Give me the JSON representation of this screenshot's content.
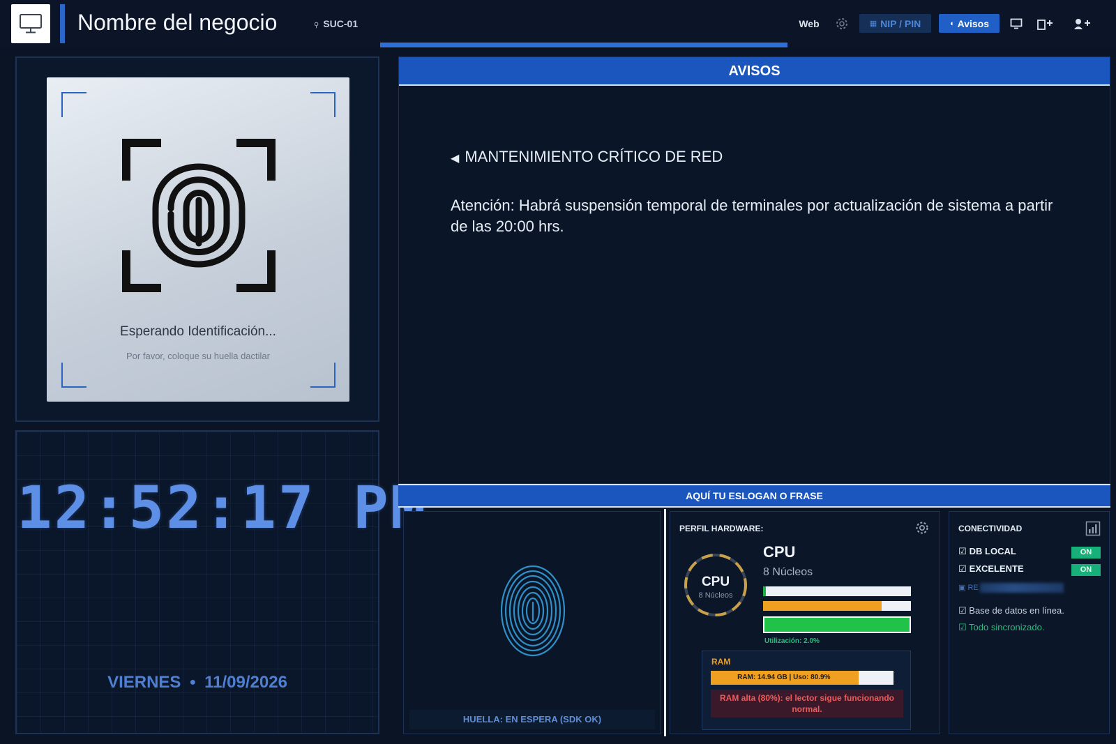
{
  "header": {
    "business_name": "Nombre del negocio",
    "branch": "SUC-01",
    "progress": 1,
    "nav": {
      "web": "Web",
      "nip_pin": "NIP / PIN",
      "avisos": "Avisos"
    },
    "icons": [
      "monitor-icon",
      "gear-icon",
      "keypad-icon",
      "megaphone-icon",
      "screen-icon",
      "add-device-icon",
      "add-user-icon"
    ]
  },
  "scanner": {
    "status": "Esperando Identificación...",
    "hint": "Por favor, coloque su huella dactilar"
  },
  "clock": {
    "time": "12:52:17 PM",
    "day": "VIERNES",
    "date": "11/09/2026"
  },
  "avisos": {
    "header": "AVISOS",
    "notice_title": "MANTENIMIENTO CRÍTICO DE RED",
    "notice_body": "Atención: Habrá suspensión temporal de terminales por actualización de sistema a partir de las 20:00 hrs."
  },
  "slogan": "AQUÍ TU ESLOGAN O FRASE",
  "huella": {
    "status": "HUELLA: EN ESPERA (SDK OK)"
  },
  "hardware": {
    "label": "PERFIL HARDWARE:",
    "gauge_title": "CPU",
    "gauge_sub": "8 Núcleos",
    "cpu_title": "CPU",
    "cpu_cores": "8 Núcleos",
    "bars": [
      0.02,
      0.8,
      1.0
    ],
    "utilization": "Utilización: 2.0%",
    "ram": {
      "label": "RAM",
      "usage": 0.809,
      "text": "RAM: 14.94 GB | Uso: 80.9%",
      "alert": "RAM alta (80%): el lector sigue funcionando normal."
    }
  },
  "connectivity": {
    "label": "CONECTIVIDAD",
    "rows": [
      {
        "label": "DB LOCAL",
        "status": "ON"
      },
      {
        "label": "EXCELENTE",
        "status": "ON"
      }
    ],
    "partial": "RE",
    "note_db": "Base de datos en línea.",
    "note_sync": "Todo sincronizado."
  },
  "colors": {
    "background": "#0a1424",
    "accent_blue": "#1a56bd",
    "clock_blue": "#5d8fe6",
    "ok_green": "#18b07a",
    "warn_orange": "#f0a020",
    "alert_red": "#f05a5a"
  }
}
